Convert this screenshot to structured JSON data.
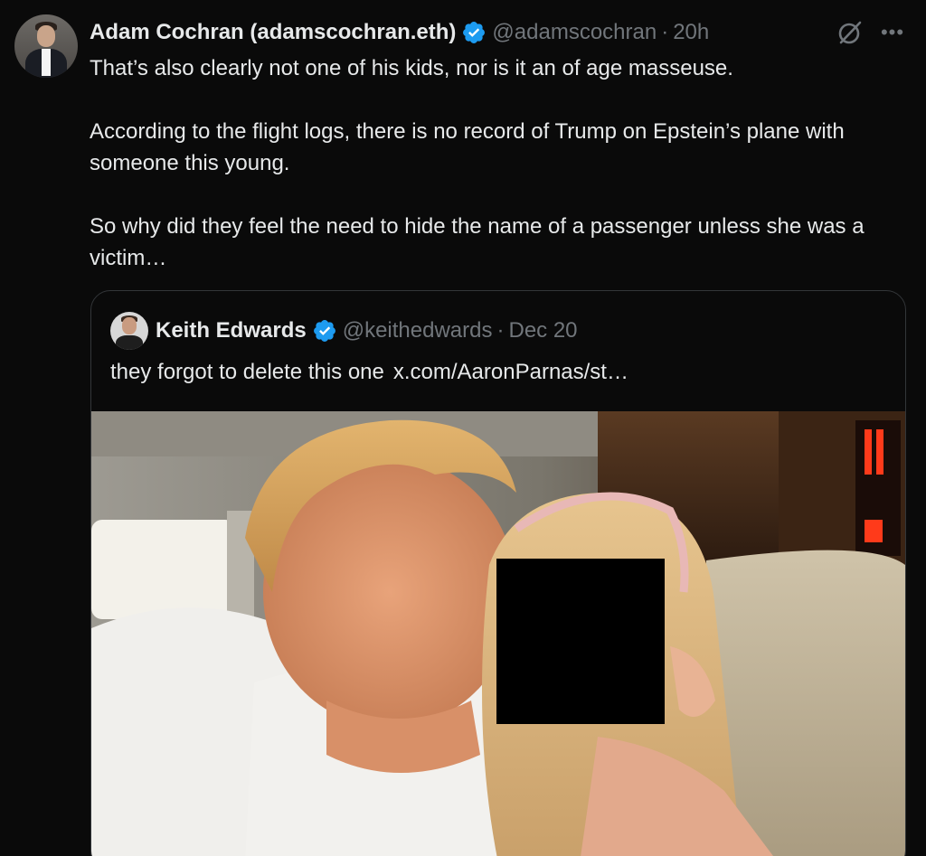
{
  "post": {
    "author_name": "Adam Cochran (adamscochran.eth)",
    "handle": "@adamscochran",
    "separator": "·",
    "time": "20h",
    "paragraphs": [
      "That’s also clearly not one of his kids, nor is it an of age masseuse.",
      "According to the flight logs, there is no record of Trump on Epstein’s plane with someone this young.",
      "So why did they feel the need to hide the name of a passenger unless she was a victim…"
    ],
    "more_glyph": "•••"
  },
  "quote": {
    "author_name": "Keith Edwards",
    "handle": "@keithedwards",
    "separator": "·",
    "date": "Dec 20",
    "text": "they forgot to delete this one",
    "link": "x.com/AaronParnas/st…"
  },
  "colors": {
    "background": "#0a0a0a",
    "text_primary": "#e7e9ea",
    "text_secondary": "#71767b",
    "verified_blue": "#1d9bf0",
    "border": "#333639"
  },
  "icons": {
    "verified": "verified-badge-icon",
    "grok": "grok-icon",
    "more": "more-options-icon"
  }
}
